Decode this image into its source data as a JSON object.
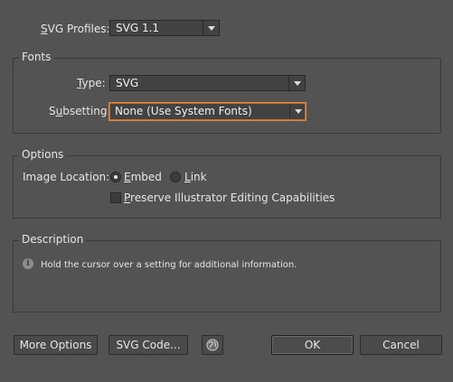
{
  "svg_profiles": {
    "label": "SVG Profiles:",
    "value": "SVG 1.1"
  },
  "fonts": {
    "title": "Fonts",
    "type_label": "Type:",
    "type_value": "SVG",
    "subsetting_label": "Subsetting:",
    "subsetting_value": "None (Use System Fonts)"
  },
  "options": {
    "title": "Options",
    "image_location_label": "Image Location:",
    "embed_label": "Embed",
    "link_label": "Link",
    "selected": "Embed",
    "preserve_label": "Preserve Illustrator Editing Capabilities",
    "preserve_checked": false
  },
  "description": {
    "title": "Description",
    "text": "Hold the cursor over a setting for additional information."
  },
  "buttons": {
    "more_options": "More Options",
    "svg_code": "SVG Code...",
    "ok": "OK",
    "cancel": "Cancel"
  },
  "icons": {
    "info": "info-icon",
    "web": "globe-icon"
  },
  "colors": {
    "background": "#535353",
    "focus_accent": "#e8873a"
  }
}
